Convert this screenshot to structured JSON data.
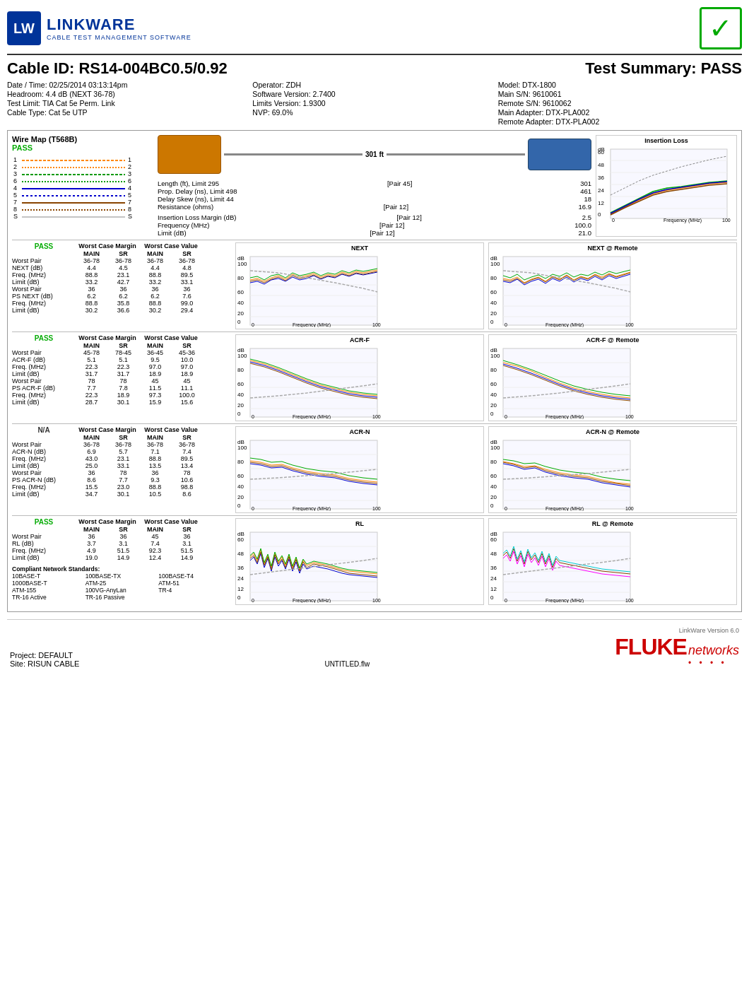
{
  "header": {
    "logo_name": "LINKWARE",
    "logo_sub": "CABLE TEST MANAGEMENT SOFTWARE",
    "logo_lw": "LW",
    "pass_check": "✓"
  },
  "cable": {
    "id_label": "Cable ID: RS14-004BC0.5/0.92",
    "test_summary_label": "Test Summary: PASS"
  },
  "info": {
    "datetime": "Date / Time: 02/25/2014 03:13:14pm",
    "headroom": "Headroom: 4.4 dB (NEXT 36-78)",
    "test_limit": "Test Limit: TIA Cat 5e Perm. Link",
    "cable_type": "Cable Type: Cat 5e UTP",
    "operator": "Operator: ZDH",
    "software_ver": "Software Version: 2.7400",
    "limits_ver": "Limits Version: 1.9300",
    "nvp": "NVP: 69.0%",
    "model": "Model: DTX-1800",
    "main_sn": "Main S/N: 9610061",
    "remote_sn": "Remote S/N: 9610062",
    "main_adapter": "Main Adapter: DTX-PLA002",
    "remote_adapter": "Remote Adapter: DTX-PLA002"
  },
  "wire_map": {
    "title": "Wire Map (T568B)",
    "status": "PASS",
    "pairs": [
      {
        "left": "1",
        "right": "1",
        "color": "#ff8800"
      },
      {
        "left": "2",
        "right": "2",
        "color": "#ff8800"
      },
      {
        "left": "3",
        "right": "3",
        "color": "#009900"
      },
      {
        "left": "6",
        "right": "6",
        "color": "#009900"
      },
      {
        "left": "4",
        "right": "4",
        "color": "#0000cc"
      },
      {
        "left": "5",
        "right": "5",
        "color": "#0000cc"
      },
      {
        "left": "7",
        "right": "7",
        "color": "#884400"
      },
      {
        "left": "8",
        "right": "8",
        "color": "#884400"
      },
      {
        "left": "S",
        "right": "S",
        "color": "#888888"
      }
    ]
  },
  "distance": "301 ft",
  "measurements": {
    "length_label": "Length (ft), Limit 295",
    "length_pair": "[Pair 45]",
    "length_val": "301",
    "prop_delay_label": "Prop. Delay (ns), Limit 498",
    "prop_delay_val": "461",
    "delay_skew_label": "Delay Skew (ns), Limit 44",
    "delay_skew_val": "18",
    "resistance_label": "Resistance (ohms)",
    "resistance_pair": "[Pair 12]",
    "resistance_val": "16.9",
    "il_margin_label": "Insertion Loss Margin (dB)",
    "il_margin_pair": "[Pair 12]",
    "il_margin_val": "2.5",
    "freq_label": "Frequency (MHz)",
    "freq_pair": "[Pair 12]",
    "freq_val": "100.0",
    "limit_label": "Limit (dB)",
    "limit_pair": "[Pair 12]",
    "limit_val": "21.0"
  },
  "next_section": {
    "status": "PASS",
    "headers": [
      "",
      "Worst Case Margin",
      "",
      "Worst Case Value",
      ""
    ],
    "sub_headers": [
      "",
      "MAIN",
      "SR",
      "MAIN",
      "SR"
    ],
    "rows": [
      {
        "label": "Worst Pair",
        "main_m": "36-78",
        "sr_m": "36-78",
        "main_v": "36-78",
        "sr_v": "36-78"
      },
      {
        "label": "NEXT (dB)",
        "main_m": "4.4",
        "sr_m": "4.5",
        "main_v": "4.4",
        "sr_v": "4.8"
      },
      {
        "label": "Freq. (MHz)",
        "main_m": "88.8",
        "sr_m": "23.1",
        "main_v": "88.8",
        "sr_v": "89.5"
      },
      {
        "label": "Limit (dB)",
        "main_m": "33.2",
        "sr_m": "42.7",
        "main_v": "33.2",
        "sr_v": "33.1"
      },
      {
        "label": "Worst Pair",
        "main_m": "36",
        "sr_m": "36",
        "main_v": "36",
        "sr_v": "36"
      },
      {
        "label": "PS NEXT (dB)",
        "main_m": "6.2",
        "sr_m": "6.2",
        "main_v": "6.2",
        "sr_v": "7.6"
      },
      {
        "label": "Freq. (MHz)",
        "main_m": "88.8",
        "sr_m": "35.8",
        "main_v": "88.8",
        "sr_v": "99.0"
      },
      {
        "label": "Limit (dB)",
        "main_m": "30.2",
        "sr_m": "36.6",
        "main_v": "30.2",
        "sr_v": "29.4"
      }
    ]
  },
  "acrf_section": {
    "status": "PASS",
    "rows": [
      {
        "label": "Worst Pair",
        "main_m": "45-78",
        "sr_m": "78-45",
        "main_v": "36-45",
        "sr_v": "45-36"
      },
      {
        "label": "ACR-F (dB)",
        "main_m": "5.1",
        "sr_m": "5.1",
        "main_v": "9.5",
        "sr_v": "10.0"
      },
      {
        "label": "Freq. (MHz)",
        "main_m": "22.3",
        "sr_m": "22.3",
        "main_v": "97.0",
        "sr_v": "97.0"
      },
      {
        "label": "Limit (dB)",
        "main_m": "31.7",
        "sr_m": "31.7",
        "main_v": "18.9",
        "sr_v": "18.9"
      },
      {
        "label": "Worst Pair",
        "main_m": "78",
        "sr_m": "78",
        "main_v": "45",
        "sr_v": "45"
      },
      {
        "label": "PS ACR-F (dB)",
        "main_m": "7.7",
        "sr_m": "7.8",
        "main_v": "11.5",
        "sr_v": "11.1"
      },
      {
        "label": "Freq. (MHz)",
        "main_m": "22.3",
        "sr_m": "18.9",
        "main_v": "97.3",
        "sr_v": "100.0"
      },
      {
        "label": "Limit (dB)",
        "main_m": "28.7",
        "sr_m": "30.1",
        "main_v": "15.9",
        "sr_v": "15.6"
      }
    ]
  },
  "acrn_section": {
    "status": "N/A",
    "rows": [
      {
        "label": "Worst Pair",
        "main_m": "36-78",
        "sr_m": "36-78",
        "main_v": "36-78",
        "sr_v": "36-78"
      },
      {
        "label": "ACR-N (dB)",
        "main_m": "6.9",
        "sr_m": "5.7",
        "main_v": "7.1",
        "sr_v": "7.4"
      },
      {
        "label": "Freq. (MHz)",
        "main_m": "43.0",
        "sr_m": "23.1",
        "main_v": "88.8",
        "sr_v": "89.5"
      },
      {
        "label": "Limit (dB)",
        "main_m": "25.0",
        "sr_m": "33.1",
        "main_v": "13.5",
        "sr_v": "13.4"
      },
      {
        "label": "Worst Pair",
        "main_m": "36",
        "sr_m": "78",
        "main_v": "36",
        "sr_v": "78"
      },
      {
        "label": "PS ACR-N (dB)",
        "main_m": "8.6",
        "sr_m": "7.7",
        "main_v": "9.3",
        "sr_v": "10.6"
      },
      {
        "label": "Freq. (MHz)",
        "main_m": "15.5",
        "sr_m": "23.0",
        "main_v": "88.8",
        "sr_v": "98.8"
      },
      {
        "label": "Limit (dB)",
        "main_m": "34.7",
        "sr_m": "30.1",
        "main_v": "10.5",
        "sr_v": "8.6"
      }
    ]
  },
  "rl_section": {
    "status": "PASS",
    "rows": [
      {
        "label": "Worst Pair",
        "main_m": "36",
        "sr_m": "36",
        "main_v": "45",
        "sr_v": "36"
      },
      {
        "label": "RL (dB)",
        "main_m": "3.7",
        "sr_m": "3.1",
        "main_v": "7.4",
        "sr_v": "3.1"
      },
      {
        "label": "Freq. (MHz)",
        "main_m": "4.9",
        "sr_m": "51.5",
        "main_v": "92.3",
        "sr_v": "51.5"
      },
      {
        "label": "Limit (dB)",
        "main_m": "19.0",
        "sr_m": "14.9",
        "main_v": "12.4",
        "sr_v": "14.9"
      }
    ]
  },
  "standards": {
    "title": "Compliant Network Standards:",
    "col1": [
      "10BASE-T",
      "1000BASE-T",
      "ATM-155",
      "TR-16 Active"
    ],
    "col2": [
      "100BASE-TX",
      "ATM-25",
      "100VG-AnyLan",
      "TR-16 Passive"
    ],
    "col3": [
      "100BASE-T4",
      "ATM-51",
      "TR-4",
      ""
    ]
  },
  "footer": {
    "project": "Project: DEFAULT",
    "site": "Site: RISUN CABLE",
    "filename": "UNTITLED.flw",
    "lw_version": "LinkWare Version 6.0",
    "fluke": "FLUKE",
    "networks": "networks"
  },
  "charts": {
    "next_title": "NEXT",
    "next_remote_title": "NEXT @ Remote",
    "acrf_title": "ACR-F",
    "acrf_remote_title": "ACR-F @ Remote",
    "acrn_title": "ACR-N",
    "acrn_remote_title": "ACR-N @ Remote",
    "rl_title": "RL",
    "rl_remote_title": "RL @ Remote",
    "il_title": "Insertion Loss",
    "x_axis": "Frequency (MHz)",
    "x_max": "100",
    "db_label": "dB"
  }
}
